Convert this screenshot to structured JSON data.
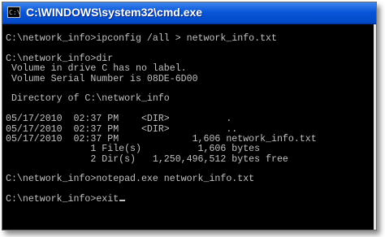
{
  "window": {
    "title": "C:\\WINDOWS\\system32\\cmd.exe",
    "icon": "console-icon",
    "icon_text": "C:\\"
  },
  "console": {
    "lines": [
      "",
      "C:\\network_info>ipconfig /all > network_info.txt",
      "",
      "C:\\network_info>dir",
      " Volume in drive C has no label.",
      " Volume Serial Number is 08DE-6D00",
      "",
      " Directory of C:\\network_info",
      "",
      "05/17/2010  02:37 PM    <DIR>          .",
      "05/17/2010  02:37 PM    <DIR>          ..",
      "05/17/2010  02:37 PM             1,606 network_info.txt",
      "               1 File(s)          1,606 bytes",
      "               2 Dir(s)   1,250,496,512 bytes free",
      "",
      "C:\\network_info>notepad.exe network_info.txt",
      "",
      "C:\\network_info>exit"
    ]
  },
  "colors": {
    "titlebar": "#0a56d8",
    "console_bg": "#000000",
    "console_text": "#c0c0c0"
  }
}
